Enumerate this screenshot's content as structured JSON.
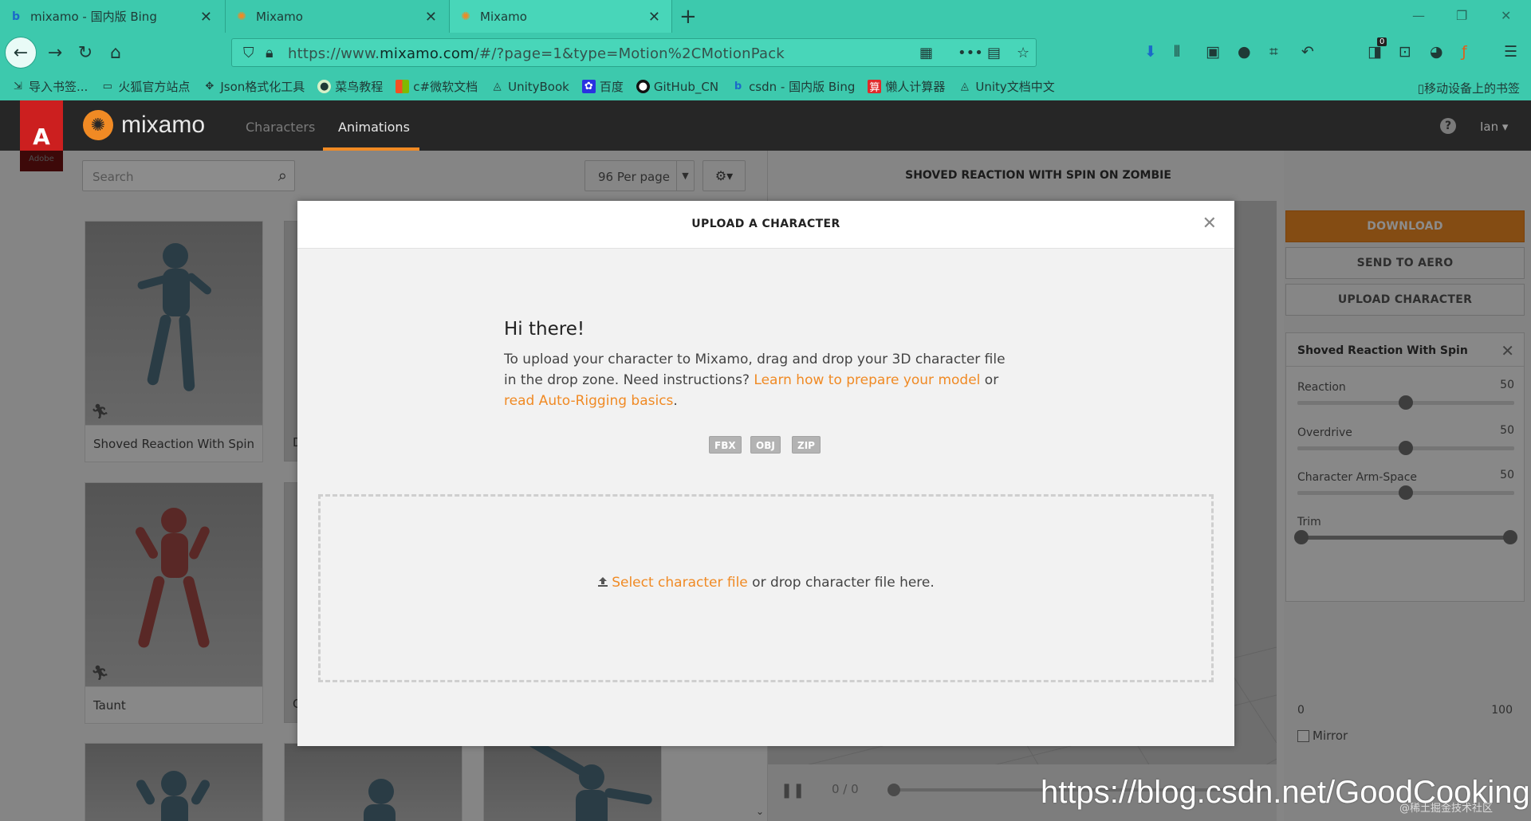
{
  "browser": {
    "tabs": [
      {
        "title": "mixamo - 国内版 Bing",
        "icon": "bing-icon"
      },
      {
        "title": "Mixamo",
        "icon": "mixamo-icon"
      },
      {
        "title": "Mixamo",
        "icon": "mixamo-icon",
        "active": true
      }
    ],
    "url_prefix": "https://www.",
    "url_domain": "mixamo.com",
    "url_suffix": "/#/?page=1&type=Motion%2CMotionPack",
    "download_badge": "0",
    "bookmarks": [
      "导入书签...",
      "火狐官方站点",
      "Json格式化工具",
      "菜鸟教程",
      "c#微软文档",
      "UnityBook",
      "百度",
      "GitHub_CN",
      "csdn - 国内版 Bing",
      "懒人计算器",
      "Unity文档中文"
    ],
    "mobile_bookmarks": "移动设备上的书签"
  },
  "mixamo": {
    "adobe_label": "Adobe",
    "logo_text": "mixamo",
    "nav": {
      "characters": "Characters",
      "animations": "Animations"
    },
    "help": "?",
    "user": "Ian",
    "search_placeholder": "Search",
    "per_page": "96 Per page",
    "cards": [
      {
        "name": "Shoved Reaction With Spin"
      },
      {
        "name": "Taunt"
      }
    ],
    "ghost_card_letters": [
      "D",
      "C"
    ],
    "preview_title": "SHOVED REACTION WITH SPIN ON ZOMBIE",
    "frame_counter": "0 / 0",
    "buttons": {
      "download": "DOWNLOAD",
      "send_to_aero": "SEND TO AERO",
      "upload_character": "UPLOAD CHARACTER"
    },
    "panel": {
      "title": "Shoved Reaction With Spin",
      "params": [
        {
          "label": "Reaction",
          "value": "50",
          "fraction": 0.5
        },
        {
          "label": "Overdrive",
          "value": "50",
          "fraction": 0.5
        },
        {
          "label": "Character Arm-Space",
          "value": "50",
          "fraction": 0.5
        }
      ],
      "trim_label": "Trim",
      "trim_min": "0",
      "trim_max": "100",
      "mirror_label": "Mirror"
    }
  },
  "modal": {
    "title": "UPLOAD A CHARACTER",
    "greeting": "Hi there!",
    "desc_part1": "To upload your character to Mixamo, drag and drop your 3D character file in the drop zone. Need instructions? ",
    "link1": "Learn how to prepare your model",
    "desc_part2": " or ",
    "link2": "read Auto-Rigging basics",
    "desc_part3": ".",
    "file_types": [
      "FBX",
      "OBJ",
      "ZIP"
    ],
    "select_link": "Select character file",
    "drop_text": " or drop character file here."
  },
  "watermark": {
    "url": "https://blog.csdn.net/GoodCooking",
    "small": "@稀土掘金技术社区"
  },
  "colors": {
    "accent": "#f08a24",
    "browser_chrome": "#3dc9ad",
    "highlight": "#e0282f"
  }
}
